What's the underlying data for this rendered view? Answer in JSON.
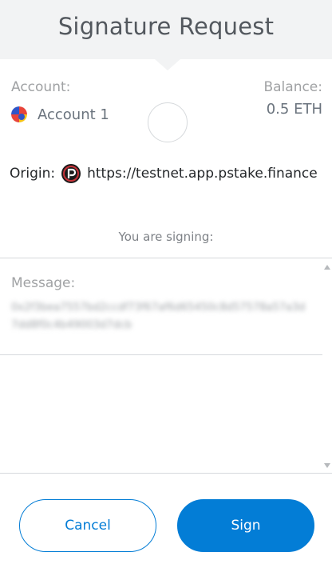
{
  "header": {
    "title": "Signature Request"
  },
  "account": {
    "label": "Account:",
    "name": "Account 1",
    "avatar_icon": "account-identicon",
    "avatar_colors": [
      "#e8443a",
      "#2f55c8",
      "#f5c418",
      "#f0efe9"
    ]
  },
  "balance": {
    "label": "Balance:",
    "value": "0.5 ETH"
  },
  "origin": {
    "label": "Origin:",
    "icon": "pstake-logo-icon",
    "url": "https://testnet.app.pstake.finance"
  },
  "signing": {
    "label": "You are signing:"
  },
  "message": {
    "label": "Message:",
    "value": "0x2f3bea7557bd2ccdf73f67af6d65450c8d57578a57a3d7dd8f0c4b49003d7dcb"
  },
  "buttons": {
    "cancel_label": "Cancel",
    "sign_label": "Sign"
  },
  "colors": {
    "accent": "#037dd6",
    "header_bg": "#f2f3f4"
  }
}
